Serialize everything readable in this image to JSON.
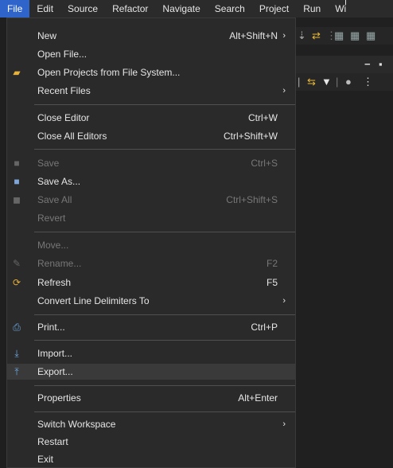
{
  "menubar": {
    "items": [
      "File",
      "Edit",
      "Source",
      "Refactor",
      "Navigate",
      "Search",
      "Project",
      "Run",
      "Wi"
    ]
  },
  "file_menu": {
    "items": [
      {
        "label": "New",
        "accel": "Alt+Shift+N",
        "submenu": true,
        "icon": "",
        "disabled": false
      },
      {
        "label": "Open File...",
        "accel": "",
        "submenu": false,
        "icon": "",
        "disabled": false
      },
      {
        "label": "Open Projects from File System...",
        "accel": "",
        "submenu": false,
        "icon": "folder-icon",
        "disabled": false
      },
      {
        "label": "Recent Files",
        "accel": "",
        "submenu": true,
        "icon": "",
        "disabled": false
      },
      {
        "label": "Close Editor",
        "accel": "Ctrl+W",
        "submenu": false,
        "icon": "",
        "disabled": false
      },
      {
        "label": "Close All Editors",
        "accel": "Ctrl+Shift+W",
        "submenu": false,
        "icon": "",
        "disabled": false
      },
      {
        "label": "Save",
        "accel": "Ctrl+S",
        "submenu": false,
        "icon": "save-icon",
        "disabled": true
      },
      {
        "label": "Save As...",
        "accel": "",
        "submenu": false,
        "icon": "save-as-icon",
        "disabled": false
      },
      {
        "label": "Save All",
        "accel": "Ctrl+Shift+S",
        "submenu": false,
        "icon": "save-all-icon",
        "disabled": true
      },
      {
        "label": "Revert",
        "accel": "",
        "submenu": false,
        "icon": "",
        "disabled": true
      },
      {
        "label": "Move...",
        "accel": "",
        "submenu": false,
        "icon": "",
        "disabled": true
      },
      {
        "label": "Rename...",
        "accel": "F2",
        "submenu": false,
        "icon": "rename-icon",
        "disabled": true
      },
      {
        "label": "Refresh",
        "accel": "F5",
        "submenu": false,
        "icon": "refresh-icon",
        "disabled": false
      },
      {
        "label": "Convert Line Delimiters To",
        "accel": "",
        "submenu": true,
        "icon": "",
        "disabled": false
      },
      {
        "label": "Print...",
        "accel": "Ctrl+P",
        "submenu": false,
        "icon": "print-icon",
        "disabled": false
      },
      {
        "label": "Import...",
        "accel": "",
        "submenu": false,
        "icon": "import-icon",
        "disabled": false
      },
      {
        "label": "Export...",
        "accel": "",
        "submenu": false,
        "icon": "export-icon",
        "disabled": false,
        "highlighted": true
      },
      {
        "label": "Properties",
        "accel": "Alt+Enter",
        "submenu": false,
        "icon": "",
        "disabled": false
      },
      {
        "label": "Switch Workspace",
        "accel": "",
        "submenu": true,
        "icon": "",
        "disabled": false
      },
      {
        "label": "Restart",
        "accel": "",
        "submenu": false,
        "icon": "",
        "disabled": false
      },
      {
        "label": "Exit",
        "accel": "",
        "submenu": false,
        "icon": "",
        "disabled": false
      }
    ]
  },
  "colors": {
    "menubar_active": "#2f65ca",
    "menu_bg": "#2a2a2a",
    "highlight": "#3a3a3a",
    "disabled_text": "#777777"
  }
}
